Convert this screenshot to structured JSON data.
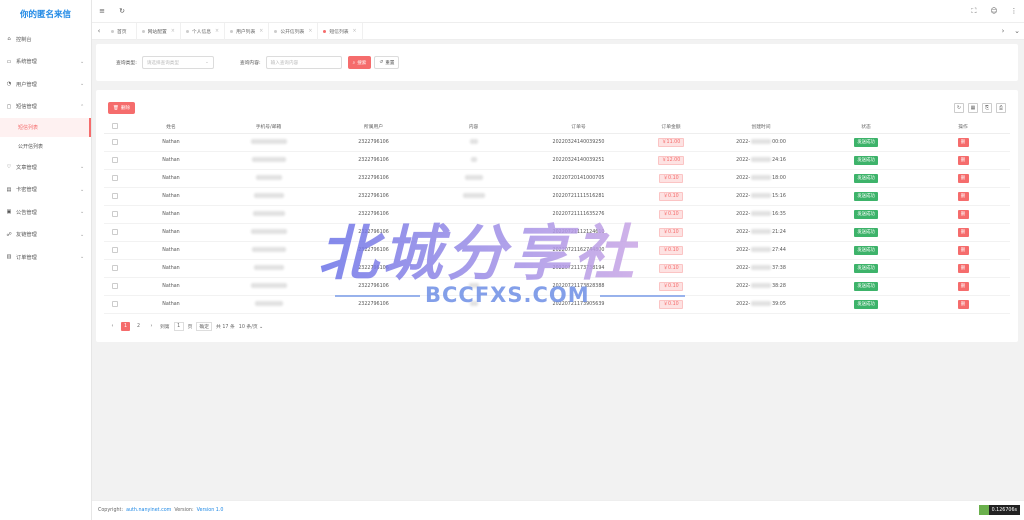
{
  "sidebar": {
    "logo": "你的匿名来信",
    "items": [
      {
        "label": "控制台",
        "icon": "home-icon",
        "chev": ""
      },
      {
        "label": "系统管理",
        "icon": "monitor-icon",
        "chev": "⌄"
      },
      {
        "label": "用户管理",
        "icon": "user-icon",
        "chev": "⌄"
      },
      {
        "label": "短信管理",
        "icon": "message-icon",
        "chev": "⌃"
      }
    ],
    "sub": [
      {
        "label": "短信列表",
        "active": true
      },
      {
        "label": "公开信列表",
        "active": false
      }
    ],
    "items2": [
      {
        "label": "文章管理",
        "icon": "heart-icon",
        "chev": "⌄"
      },
      {
        "label": "卡密管理",
        "icon": "card-icon",
        "chev": "⌄"
      },
      {
        "label": "公告管理",
        "icon": "notice-icon",
        "chev": "⌄"
      },
      {
        "label": "友链管理",
        "icon": "link-icon",
        "chev": "⌄"
      },
      {
        "label": "订单管理",
        "icon": "order-icon",
        "chev": "⌄"
      }
    ]
  },
  "tabs": [
    {
      "label": "首页",
      "close": ""
    },
    {
      "label": "网站配置",
      "close": "×"
    },
    {
      "label": "个人信息",
      "close": "×"
    },
    {
      "label": "用户列表",
      "close": "×"
    },
    {
      "label": "公开信列表",
      "close": "×"
    },
    {
      "label": "短信列表",
      "close": "×"
    }
  ],
  "search": {
    "type_label": "查询类型:",
    "type_placeholder": "请选择查询类型",
    "content_label": "查询内容:",
    "content_placeholder": "输入查询内容",
    "search_btn": "搜索",
    "reset_btn": "重置"
  },
  "table": {
    "delete_btn": "删除",
    "headers": [
      "姓名",
      "手机号/邮箱",
      "所属用户",
      "内容",
      "订单号",
      "订单金额",
      "创建时间",
      "状态",
      "操作"
    ],
    "rows": [
      {
        "name": "Nathan",
        "user": "2322796106",
        "order": "20220324140039250",
        "amount": "￥11.00",
        "time_pre": "2022-",
        "time_suf": "00:00"
      },
      {
        "name": "Nathan",
        "user": "2322796106",
        "order": "20220324140039251",
        "amount": "￥12.00",
        "time_pre": "2022-",
        "time_suf": "24:16"
      },
      {
        "name": "Nathan",
        "user": "2322796106",
        "order": "20220720141000705",
        "amount": "￥0.10",
        "time_pre": "2022-",
        "time_suf": "18:00"
      },
      {
        "name": "Nathan",
        "user": "2322796106",
        "order": "20220721111516281",
        "amount": "￥0.10",
        "time_pre": "2022-",
        "time_suf": "15:16"
      },
      {
        "name": "Nathan",
        "user": "2322796106",
        "order": "20220721111635276",
        "amount": "￥0.10",
        "time_pre": "2022-",
        "time_suf": "16:35"
      },
      {
        "name": "Nathan",
        "user": "2322796106",
        "order": "20220721112124610",
        "amount": "￥0.10",
        "time_pre": "2022-",
        "time_suf": "21:24"
      },
      {
        "name": "Nathan",
        "user": "2322796106",
        "order": "20220721162744800",
        "amount": "￥0.10",
        "time_pre": "2022-",
        "time_suf": "27:44"
      },
      {
        "name": "Nathan",
        "user": "2322796106",
        "order": "20220721173738194",
        "amount": "￥0.10",
        "time_pre": "2022-",
        "time_suf": "37:38"
      },
      {
        "name": "Nathan",
        "user": "2322796106",
        "order": "20220721173828388",
        "amount": "￥0.10",
        "time_pre": "2022-",
        "time_suf": "38:28"
      },
      {
        "name": "Nathan",
        "user": "2322796106",
        "order": "20220721173905639",
        "amount": "￥0.10",
        "time_pre": "2022-",
        "time_suf": "39:05"
      }
    ],
    "status_label": "发送成功",
    "op_label": "删"
  },
  "pager": {
    "prev": "‹",
    "p1": "1",
    "p2": "2",
    "next": "›",
    "goto": "到第",
    "input": "1",
    "page_unit": "页",
    "confirm": "确定",
    "total": "共 17 条",
    "size": "10 条/页"
  },
  "footer": {
    "copyright": "Copyright:",
    "domain": "auth.nanyinet.com",
    "version_label": "Version:",
    "version": "Version 1.0"
  },
  "badge": "0.126706s",
  "watermark": {
    "cn": "北城分享社",
    "en": "BCCFXS.COM"
  },
  "colors": {
    "accent": "#f56c6c",
    "brand": "#1e88e5",
    "success": "#3db36a"
  }
}
